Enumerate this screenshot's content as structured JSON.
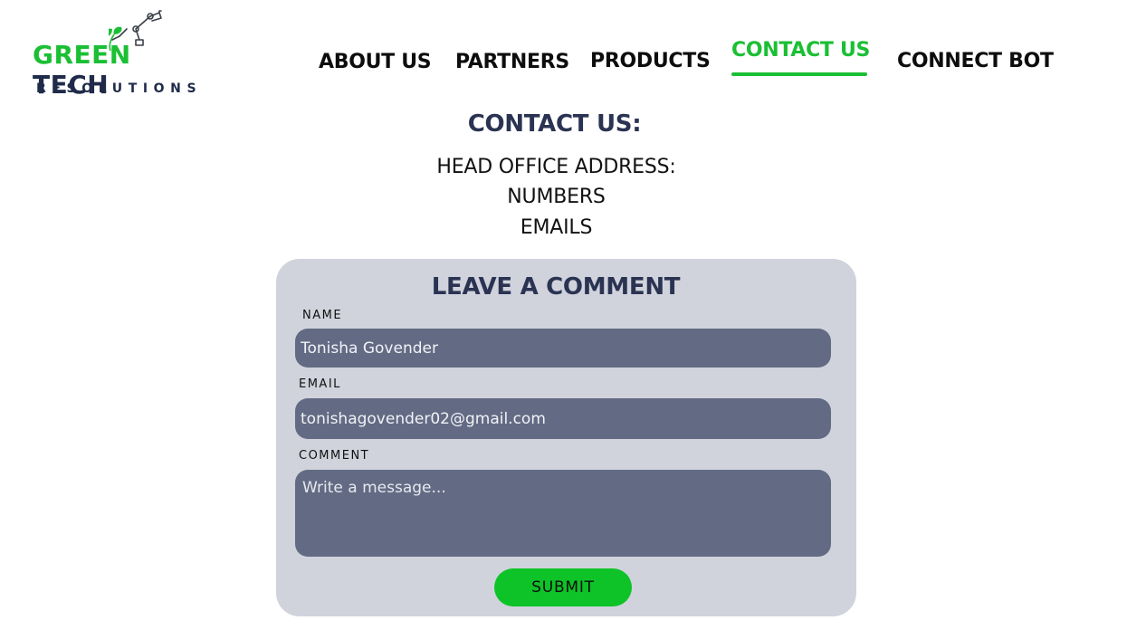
{
  "logo": {
    "word_green": "GREEN",
    "word_tech": "TECH",
    "subtitle": "RESOLUTIONS",
    "icon": "robot-arm-icon"
  },
  "nav": {
    "items": [
      {
        "label": "ABOUT US",
        "active": false
      },
      {
        "label": "PARTNERS",
        "active": false
      },
      {
        "label": "PRODUCTS",
        "active": false
      },
      {
        "label": "CONTACT US",
        "active": true
      },
      {
        "label": "CONNECT BOT",
        "active": false
      }
    ]
  },
  "contact": {
    "title": "CONTACT US:",
    "lines": [
      "HEAD OFFICE ADDRESS:",
      "NUMBERS",
      "EMAILS"
    ]
  },
  "form": {
    "title": "LEAVE A COMMENT",
    "name_label": "NAME",
    "name_value": "Tonisha Govender",
    "email_label": "EMAIL",
    "email_value": "tonishagovender02@gmail.com",
    "comment_label": "COMMENT",
    "comment_placeholder": "Write a message...",
    "submit_label": "SUBMIT"
  },
  "colors": {
    "brand_green": "#1bbf34",
    "brand_navy": "#1f2b49",
    "card_bg": "#d0d3dc",
    "field_bg": "#636b84",
    "submit_bg": "#0ec327"
  }
}
